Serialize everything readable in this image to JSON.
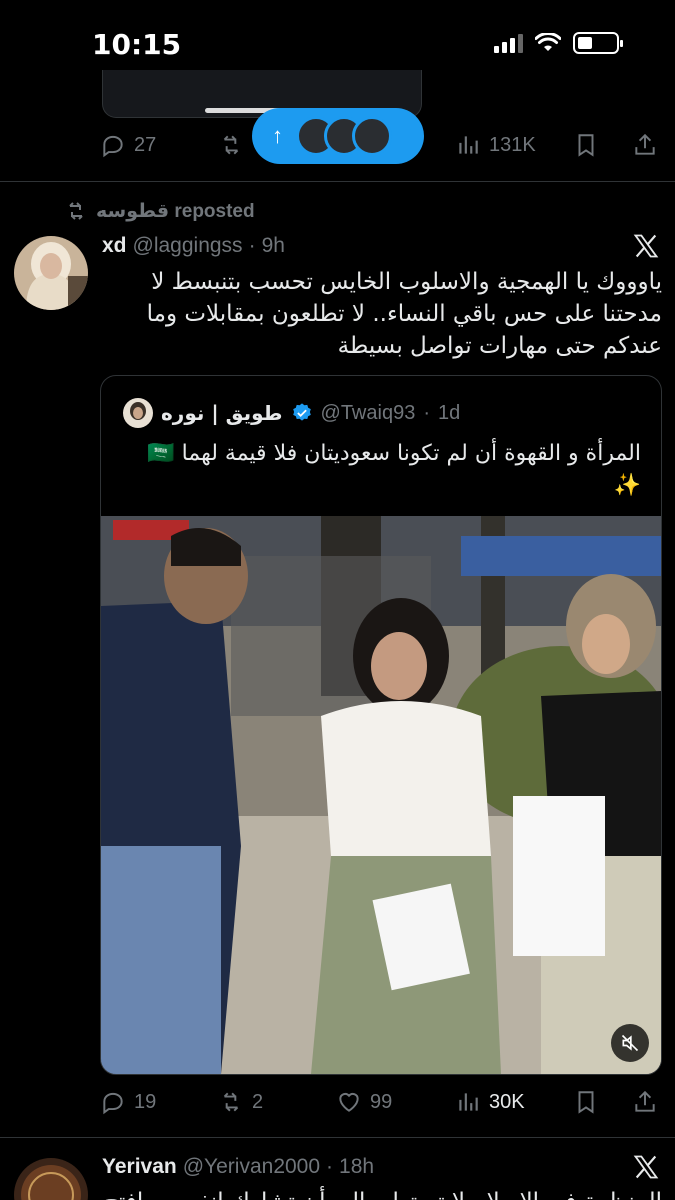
{
  "status_bar": {
    "time": "10:15"
  },
  "prev_tweet": {
    "replies": "27",
    "views": "131K"
  },
  "new_posts_pill": {
    "arrow": "↑"
  },
  "tweet": {
    "repost_label": "قطوسه reposted",
    "name": "xd",
    "handle": "@laggingss",
    "dot": "·",
    "time": "9h",
    "text": "ياوووك يا الهمجية والاسلوب الخايس تحسب بتنبسط لا مدحتنا على حس باقي النساء.. لا تطلعون بمقابلات وما عندكم حتى مهارات تواصل بسيطة",
    "quote": {
      "name": "طويق | نوره",
      "handle": "@Twaiq93",
      "dot": "·",
      "time": "1d",
      "text": "المرأة و القهوة أن لم تكونا سعوديتان فلا قيمة لهما 🇸🇦 ✨"
    },
    "stats": {
      "replies": "19",
      "reposts": "2",
      "likes": "99",
      "views": "30K"
    }
  },
  "next_tweet": {
    "name": "Yerivan",
    "handle": "@Yerivan2000",
    "dot": "·",
    "time": "18h",
    "text_partial": "المنظمة في الإسلام لا تستطيع إلى أن تشارك انفسهن افتح لها"
  },
  "colors": {
    "accent": "#1d9bf0",
    "muted": "#71767b",
    "border": "#2f3336",
    "text": "#e7e9ea"
  }
}
